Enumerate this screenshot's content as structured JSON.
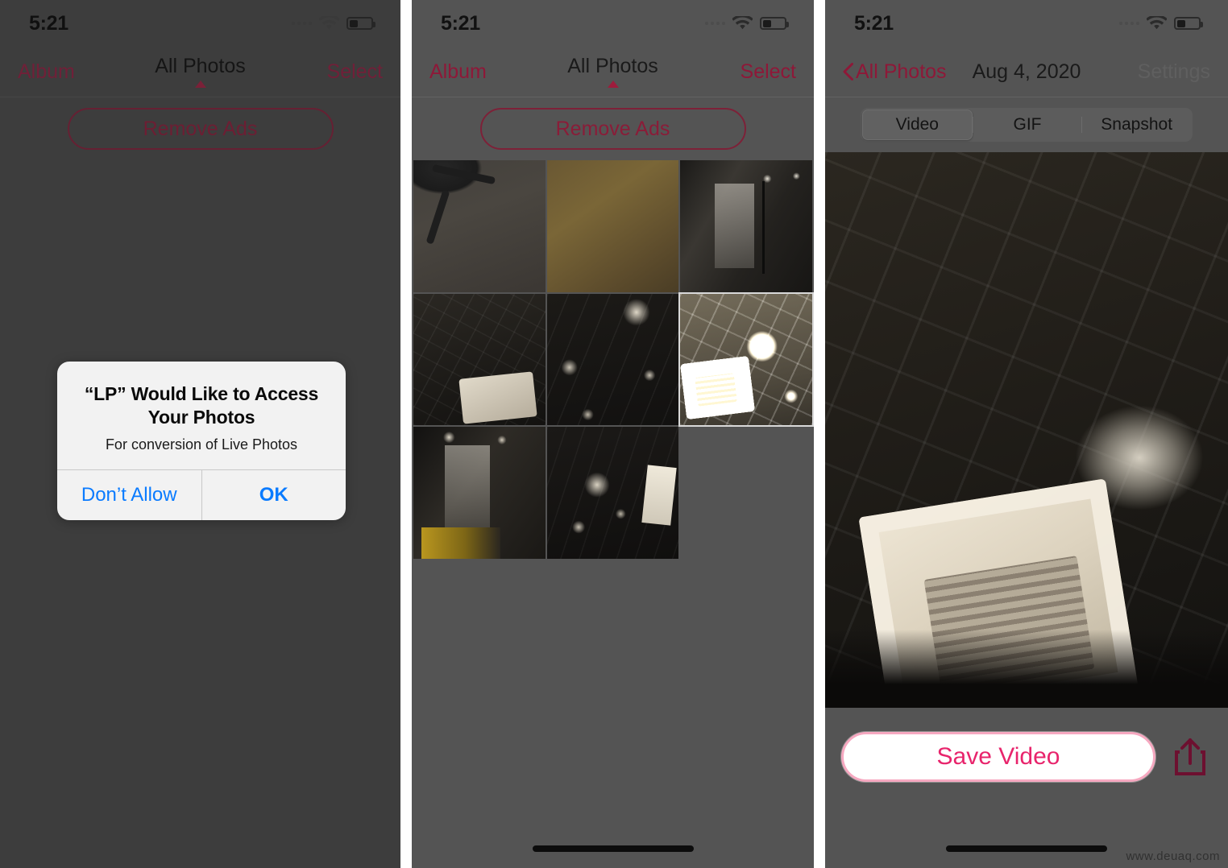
{
  "watermark": "www.deuaq.com",
  "status_bar": {
    "time": "5:21",
    "icons": [
      "cellular-dots-icon",
      "wifi-icon",
      "battery-icon"
    ]
  },
  "panels": [
    {
      "id": "panel-permission-dialog",
      "nav": {
        "left": "Album",
        "title": "All Photos",
        "right": "Select",
        "caret": "sort-caret-up-icon"
      },
      "remove_ads_label": "Remove Ads",
      "dialog": {
        "title": "“LP” Would Like to Access Your Photos",
        "message": "For conversion of Live Photos",
        "deny_label": "Don’t Allow",
        "allow_label": "OK"
      }
    },
    {
      "id": "panel-photo-grid",
      "nav": {
        "left": "Album",
        "title": "All Photos",
        "right": "Select",
        "caret": "sort-caret-up-icon"
      },
      "remove_ads_label": "Remove Ads",
      "grid": {
        "columns": 3,
        "photos": [
          {
            "name": "office-chair-floor",
            "style": "chair",
            "selected": false
          },
          {
            "name": "wooden-desk-surface",
            "style": "wood",
            "selected": false
          },
          {
            "name": "office-glass-partition",
            "style": "office",
            "selected": false
          },
          {
            "name": "ceiling-ac-unit-left",
            "style": "ceil1",
            "selected": false
          },
          {
            "name": "dark-ceiling-lights",
            "style": "ceil2",
            "selected": false
          },
          {
            "name": "ceiling-ac-unit-bright",
            "style": "ac",
            "selected": true
          },
          {
            "name": "office-interior-yellow",
            "style": "ceil3",
            "selected": false
          },
          {
            "name": "ceiling-spotlights",
            "style": "ceil4",
            "selected": false
          }
        ]
      }
    },
    {
      "id": "panel-live-photo-detail",
      "nav": {
        "back": "All Photos",
        "back_icon": "chevron-left-icon",
        "title": "Aug 4, 2020",
        "right": "Settings"
      },
      "segmented": {
        "options": [
          "Video",
          "GIF",
          "Snapshot"
        ],
        "selected": "Video"
      },
      "hero_photo": "ceiling-ac-unit-photo",
      "save_label": "Save Video",
      "share_icon": "share-upload-icon"
    }
  ],
  "colors": {
    "accent_red": "#8e1838",
    "save_pink": "#e8246c",
    "dialog_blue": "#0a7bff",
    "panel_bg": "#545454",
    "dimmed_panel_bg": "#3d3d3d"
  }
}
